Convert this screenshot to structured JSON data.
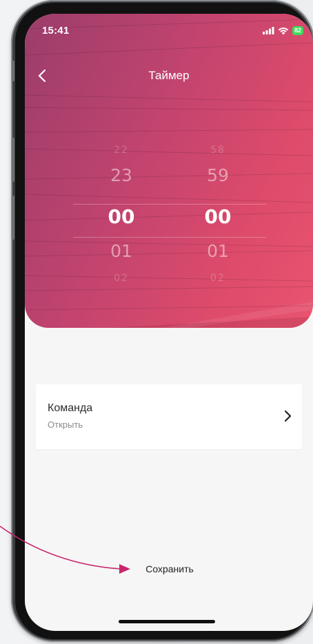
{
  "status_bar": {
    "time": "15:41",
    "battery": "82"
  },
  "header": {
    "title": "Таймер"
  },
  "picker": {
    "hours": {
      "far_above": "22",
      "above": "23",
      "selected": "00",
      "below": "01",
      "far_below": "02"
    },
    "minutes": {
      "far_above": "58",
      "above": "59",
      "selected": "00",
      "below": "01",
      "far_below": "02"
    }
  },
  "command": {
    "label": "Команда",
    "value": "Открыть"
  },
  "footer": {
    "save_label": "Сохранить"
  },
  "colors": {
    "hero_gradient_start": "#9b3d6a",
    "hero_gradient_end": "#e85470",
    "annotation_arrow": "#c8266e",
    "battery": "#3ddc5a"
  },
  "icons": [
    "back-icon",
    "cellular-signal-icon",
    "wifi-icon",
    "battery-icon",
    "chevron-right-icon",
    "annotation-arrow-icon"
  ]
}
